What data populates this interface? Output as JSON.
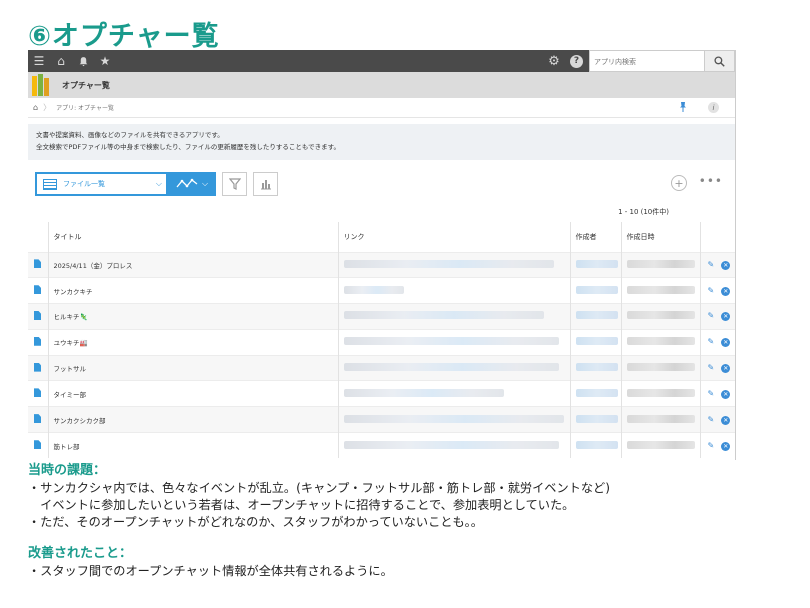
{
  "slide": {
    "title": "⑥オプチャー覧"
  },
  "topbar": {
    "menu_icon": "☰",
    "home_icon": "⌂",
    "bell_icon": "🔔",
    "star_icon": "★",
    "gear_icon": "⚙",
    "help_icon": "?",
    "search_placeholder": "アプリ内検索",
    "search_icon": "⌕"
  },
  "appbar": {
    "title": "オプチャー覧"
  },
  "breadcrumb": {
    "home_icon": "⌂",
    "separator": "〉",
    "path": "アプリ: オプチャー覧",
    "pin_icon": "📌",
    "info_icon": "i"
  },
  "description": {
    "line1": "文書や提案資料、画像などのファイルを共有できるアプリです。",
    "line2": "全文検索でPDFファイル等の中身まで検索したり、ファイルの更新履歴を残したりすることもできます。"
  },
  "toolbar": {
    "view_label": "ファイル一覧",
    "view_caret": "⌵",
    "graph_icon": "〰",
    "graph_caret": "⌵",
    "filter_icon": "▼",
    "chart_icon": "▮▮",
    "add_icon": "+",
    "more_icon": "•••"
  },
  "pager": {
    "text": "1 - 10  (10件中)"
  },
  "table": {
    "headers": [
      "タイトル",
      "リンク",
      "作成者",
      "作成日時"
    ],
    "rows": [
      {
        "title": "2025/4/11（金）プロレス"
      },
      {
        "title": "サンカクキチ"
      },
      {
        "title": "ヒルキチ🦎"
      },
      {
        "title": "ユウキチ🏭"
      },
      {
        "title": "フットサル"
      },
      {
        "title": "タイミー部"
      },
      {
        "title": "サンカクシカク部"
      },
      {
        "title": "筋トレ部"
      }
    ],
    "edit_icon": "✎",
    "delete_icon": "✕"
  },
  "notes": {
    "issue_heading": "当時の課題：",
    "issue_line1": "・サンカクシャ内では、色々なイベントが乱立。(キャンプ・フットサル部・筋トレ部・就労イベントなど)",
    "issue_line2": "　イベントに参加したいという若者は、オープンチャットに招待することで、参加表明としていた。",
    "issue_line3": "・ただ、そのオープンチャットがどれなのか、スタッフがわかっていないことも。。",
    "improve_heading": "改善されたこと：",
    "improve_line1": "・スタッフ間でのオープンチャット情報が全体共有されるように。"
  },
  "colors": {
    "accent": "#1a9b8c",
    "primary_blue": "#3498db",
    "topbar": "#4a4a4a"
  }
}
